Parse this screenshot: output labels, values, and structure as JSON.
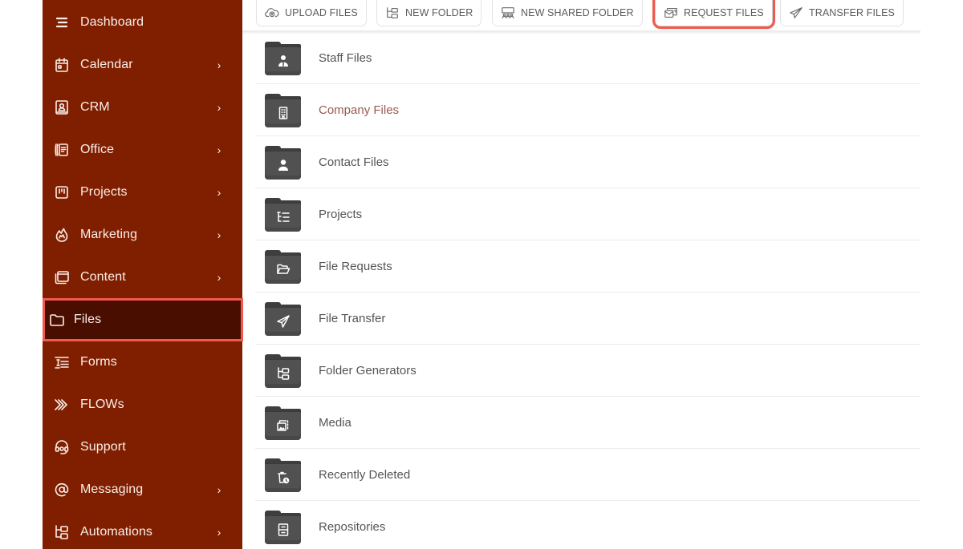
{
  "sidebar": {
    "items": [
      {
        "label": "Dashboard",
        "icon": "menu-lines-icon",
        "has_submenu": false,
        "active": false
      },
      {
        "label": "Calendar",
        "icon": "calendar-icon",
        "has_submenu": true,
        "active": false
      },
      {
        "label": "CRM",
        "icon": "contact-card-icon",
        "has_submenu": true,
        "active": false
      },
      {
        "label": "Office",
        "icon": "office-phone-icon",
        "has_submenu": true,
        "active": false
      },
      {
        "label": "Projects",
        "icon": "kanban-board-icon",
        "has_submenu": true,
        "active": false
      },
      {
        "label": "Marketing",
        "icon": "flame-icon",
        "has_submenu": true,
        "active": false
      },
      {
        "label": "Content",
        "icon": "browser-window-icon",
        "has_submenu": true,
        "active": false
      },
      {
        "label": "Files",
        "icon": "folder-icon",
        "has_submenu": false,
        "active": true
      },
      {
        "label": "Forms",
        "icon": "form-list-icon",
        "has_submenu": false,
        "active": false
      },
      {
        "label": "FLOWs",
        "icon": "triple-chevron-icon",
        "has_submenu": false,
        "active": false
      },
      {
        "label": "Support",
        "icon": "headset-icon",
        "has_submenu": false,
        "active": false
      },
      {
        "label": "Messaging",
        "icon": "at-sign-icon",
        "has_submenu": true,
        "active": false
      },
      {
        "label": "Automations",
        "icon": "hierarchy-icon",
        "has_submenu": true,
        "active": false
      }
    ],
    "chevron": "›"
  },
  "toolbar": {
    "upload_files": "UPLOAD FILES",
    "new_folder": "NEW FOLDER",
    "new_shared_folder": "NEW SHARED FOLDER",
    "request_files": "REQUEST FILES",
    "transfer_files": "TRANSFER FILES"
  },
  "files": [
    {
      "name": "Staff Files",
      "icon": "staff-person-icon",
      "highlighted": false
    },
    {
      "name": "Company Files",
      "icon": "building-icon",
      "highlighted": true
    },
    {
      "name": "Contact Files",
      "icon": "person-icon",
      "highlighted": false
    },
    {
      "name": "Projects",
      "icon": "task-list-icon",
      "highlighted": false
    },
    {
      "name": "File Requests",
      "icon": "open-folder-icon",
      "highlighted": false
    },
    {
      "name": "File Transfer",
      "icon": "paper-plane-icon",
      "highlighted": false
    },
    {
      "name": "Folder Generators",
      "icon": "hierarchy-icon",
      "highlighted": false
    },
    {
      "name": "Media",
      "icon": "image-gallery-icon",
      "highlighted": false
    },
    {
      "name": "Recently Deleted",
      "icon": "trash-clock-icon",
      "highlighted": false
    },
    {
      "name": "Repositories",
      "icon": "cabinet-icon",
      "highlighted": false
    }
  ],
  "colors": {
    "sidebar_bg": "#7f1f00",
    "sidebar_active_bg": "#4a0e00",
    "highlight_outline": "#f05a4e",
    "folder_icon": "#515151",
    "accent_text": "#9a5a50"
  }
}
